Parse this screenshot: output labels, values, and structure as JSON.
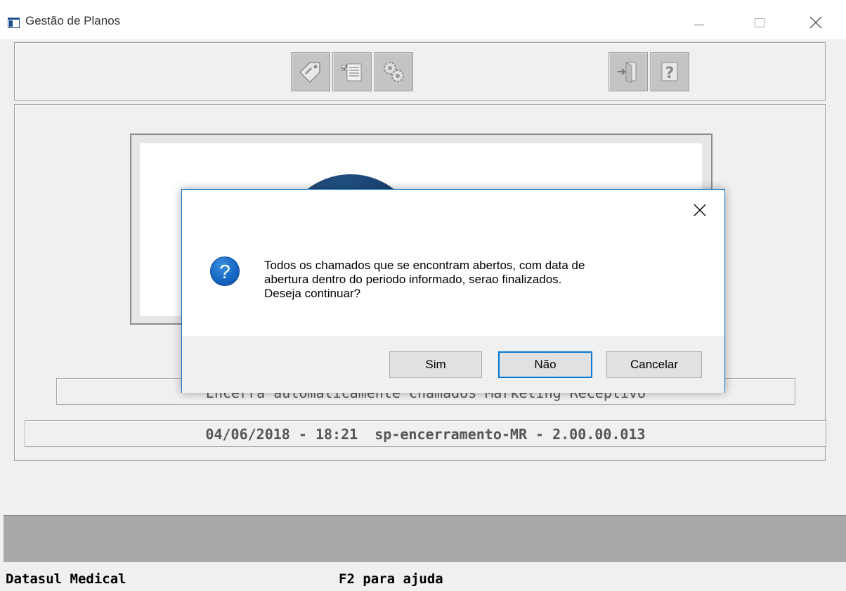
{
  "window": {
    "title": "Gestão de Planos",
    "icons": [
      "app-icon",
      "minimize-icon",
      "maximize-icon",
      "close-icon"
    ]
  },
  "toolbar": {
    "buttons": [
      {
        "name": "tag-icon"
      },
      {
        "name": "checklist-icon"
      },
      {
        "name": "gears-icon"
      },
      {
        "name": "exit-door-icon"
      },
      {
        "name": "help-icon"
      }
    ],
    "button_color": "#c4c4c4"
  },
  "main": {
    "description": "Encerra automaticamente chamados Marketing Receptivo",
    "version_line": "04/06/2018 - 18:21  sp-encerramento-MR - 2.00.00.013"
  },
  "status_bar": {
    "left_text": "Datasul Medical",
    "help_text": "F2 para ajuda"
  },
  "dialog": {
    "icon": "question-icon",
    "icon_glyph": "?",
    "message": " Todos os chamados que se encontram abertos, com data de\nabertura dentro do periodo informado, serao finalizados.\nDeseja continuar?",
    "buttons": {
      "yes": "Sim",
      "no": "Não",
      "cancel": "Cancelar"
    },
    "default_button": "no",
    "accent_color": "#0078d7"
  }
}
